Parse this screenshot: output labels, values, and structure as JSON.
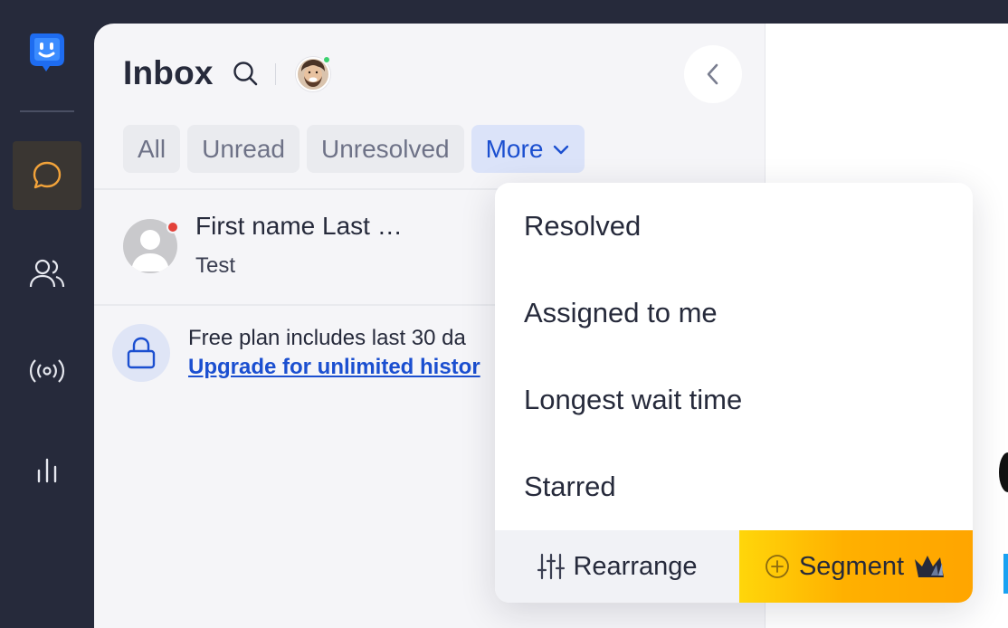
{
  "inbox": {
    "title": "Inbox"
  },
  "tabs": [
    {
      "label": "All"
    },
    {
      "label": "Unread"
    },
    {
      "label": "Unresolved"
    },
    {
      "label": "More"
    }
  ],
  "conversation": {
    "name": "First name Last …",
    "preview": "Test"
  },
  "plan_notice": {
    "text": "Free plan includes last 30 da",
    "link": "Upgrade for unlimited histor"
  },
  "more_menu": {
    "items": [
      "Resolved",
      "Assigned to me",
      "Longest wait time",
      "Starred"
    ],
    "rearrange_label": "Rearrange",
    "segment_label": "Segment"
  },
  "colors": {
    "sidebar": "#262a3b",
    "accent_blue": "#1b4fd0",
    "chat_active": "#f2a33a",
    "segment_yellow": "#ffc700",
    "online": "#3bd16f",
    "unread": "#e3413a"
  },
  "icons": [
    "app-logo-icon",
    "chat-icon",
    "contacts-icon",
    "broadcast-icon",
    "reports-icon",
    "search-icon",
    "chevron-left-icon",
    "chevron-down-icon",
    "lock-icon",
    "sliders-icon",
    "plus-circle-icon",
    "crown-icon"
  ]
}
